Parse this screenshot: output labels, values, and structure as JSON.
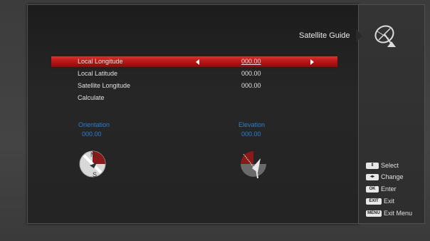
{
  "header": {
    "title": "Satellite Guide"
  },
  "rows": [
    {
      "label": "Local Longitude",
      "value": "000.00"
    },
    {
      "label": "Local Latitude",
      "value": "000.00"
    },
    {
      "label": "Satellite Longitude",
      "value": "000.00"
    },
    {
      "label": "Calculate",
      "value": ""
    }
  ],
  "results": {
    "orientation_label": "Orientation",
    "orientation_value": "000.00",
    "elevation_label": "Elevation",
    "elevation_value": "000.00"
  },
  "compass_letters": {
    "north": "N",
    "south": "S"
  },
  "legend": [
    {
      "key": "⇕",
      "label": "Select"
    },
    {
      "key": "◂▸",
      "label": "Change"
    },
    {
      "key": "OK",
      "label": "Enter"
    },
    {
      "key": "EXIT",
      "label": "Exit"
    },
    {
      "key": "MENU",
      "label": "Exit Menu"
    }
  ],
  "colors": {
    "selected_row": "#c01a1a",
    "accent_text": "#2d7fd0"
  }
}
